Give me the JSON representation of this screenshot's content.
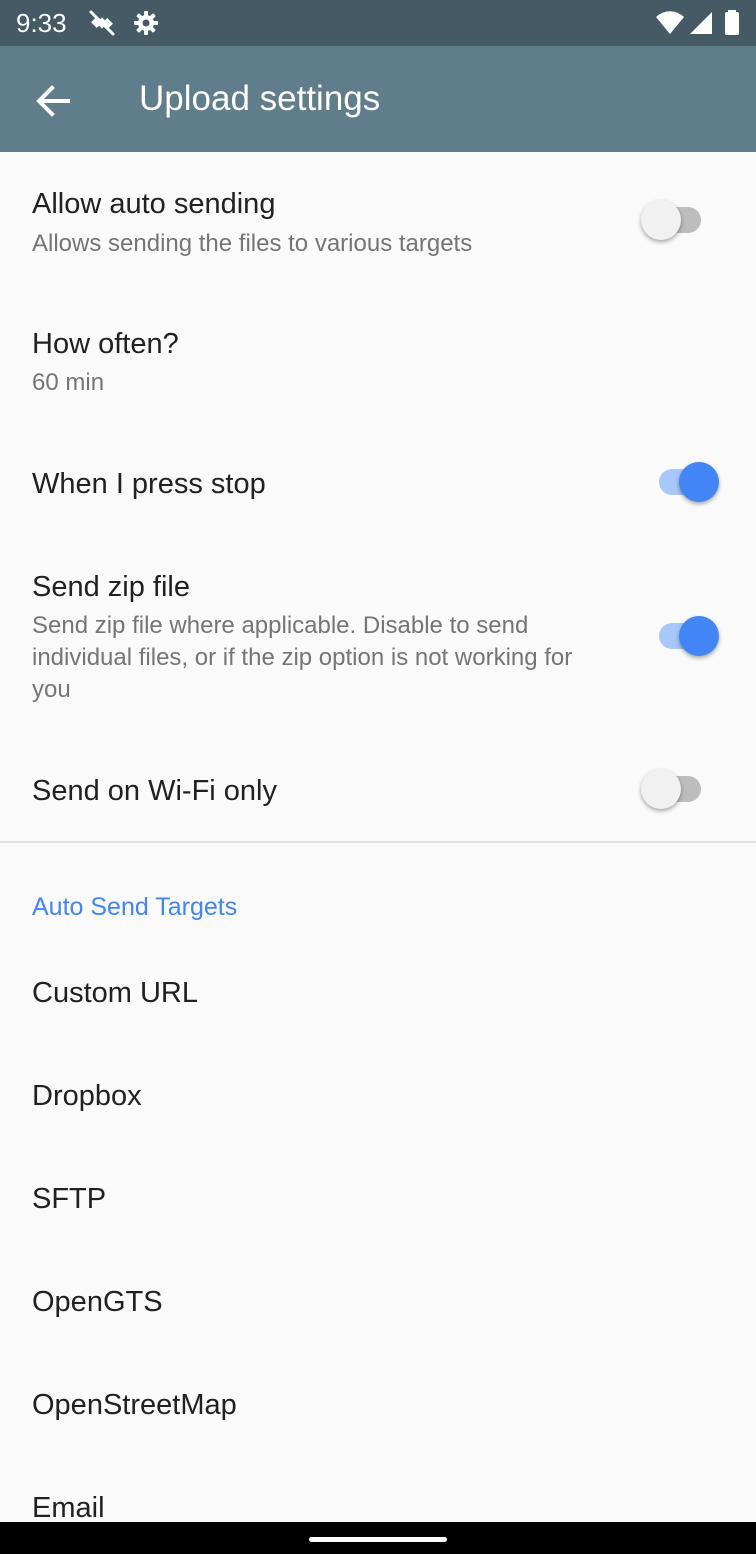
{
  "status_bar": {
    "time": "9:33",
    "icons": [
      "satellite-off-icon",
      "settings-gear-icon",
      "wifi-icon",
      "cellular-signal-icon",
      "battery-icon"
    ]
  },
  "app_bar": {
    "back_icon": "arrow-back-icon",
    "title": "Upload settings"
  },
  "preferences": {
    "auto_send": {
      "title": "Allow auto sending",
      "summary": "Allows sending the files to various targets",
      "enabled": false
    },
    "how_often": {
      "title": "How often?",
      "summary": "60 min"
    },
    "press_stop": {
      "title": "When I press stop",
      "enabled": true
    },
    "send_zip": {
      "title": "Send zip file",
      "summary": "Send zip file where applicable. Disable to send individual files, or if the zip option is not working for you",
      "enabled": true
    },
    "wifi_only": {
      "title": "Send on Wi-Fi only",
      "enabled": false
    }
  },
  "targets": {
    "category_title": "Auto Send Targets",
    "items": [
      {
        "label": "Custom URL"
      },
      {
        "label": "Dropbox"
      },
      {
        "label": "SFTP"
      },
      {
        "label": "OpenGTS"
      },
      {
        "label": "OpenStreetMap"
      },
      {
        "label": "Email"
      }
    ]
  },
  "colors": {
    "status_bar": "#455a64",
    "app_bar": "#607d8b",
    "accent": "#4285f4",
    "background": "#fafafa"
  }
}
